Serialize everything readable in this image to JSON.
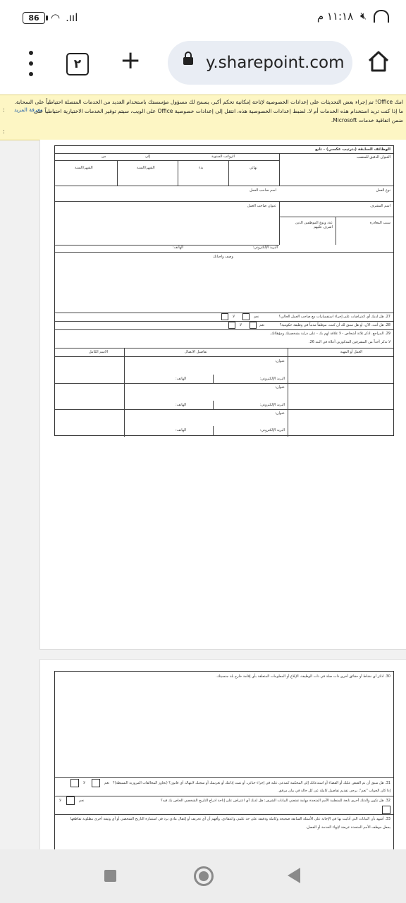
{
  "status_bar": {
    "battery": "86",
    "time": "١١:١٨ م"
  },
  "browser": {
    "tab_count": "٢",
    "url": "y.sharepoint.com"
  },
  "banner": {
    "line1": "امك Office! تم إجراء بعض التحديثات على إعدادات الخصوصية لإتاحة إمكانية تحكم أكبر، يسمح لك مسؤول مؤسستك باستخدام العديد من الخدمات المتصلة احتياطياً على السحابة.",
    "line2": "ما إذا كنت تريد استخدام هذه الخدمات أم لا. لضبط إعدادات الخصوصية هذه، انتقل إلى إعدادات خصوصية Office على الويب، سيتم توفير الخدمات الاختيارية احتياطياً على",
    "line3": "ضمن اتفاقية خدمات Microsoft.",
    "learn_more": "معرفة المزيد",
    "colon": ":"
  },
  "form": {
    "prev_jobs": "الوظائف السابقة (بترتيب عكسي) - تابع",
    "exact_title": "العنوان الدقيق للمنصب",
    "annual_salary": "الرواتب السنوية",
    "from": "من",
    "to": "إلى",
    "month_year": "الشهر/السنة",
    "final": "نهائي",
    "start": "بدء",
    "employer_name": "اسم صاحب العمل",
    "employer_address": "عنوان صاحب العمل",
    "work_type": "نوع العمل",
    "supervisor_name": "اسم المشرف",
    "leave_reason": "سبب المغادرة",
    "subordinates": "عدد ونوع الموظفين الذين اشرف عليهم",
    "email": "البريد الإلكتروني:",
    "phone": "الهاتف:",
    "duties": "وصف واجباتك",
    "q27": "27. هل لديك أي اعتراضات على إجراء استفسارات مع صاحب العمل الحالي؟",
    "q28": "28. هل أنت، الآن، أو هل سبق لك أن كنت، موظفاً مدنياً في وظيفة حكومية؟",
    "yes": "نعم",
    "no": "لا",
    "q29": "29. المراجع. اذكر ثلاثة أشخاص - لا علاقة لهم بك - على دراية بشخصيتك ومؤهلاتك.",
    "q29b": "لا تذكر أحداً من المشرفين المذكورين أعلاه في البند 26.",
    "full_name": "الاسم الكامل",
    "contact_details": "تفاصيل الاتصال",
    "job_profession": "العمل أو المهنة",
    "address": "عنوان:",
    "q30": "30. اذكر أي نشاط أو حقائق أخرى ذات صلة في ذات الوظيفة، الإبلاغ أو المعلومات المتعلقة بأي إقامة خارج بلد جنسيتك.",
    "q31": "31. هل سبق أن تم القبض عليك أو القضاء أو استدعائك إلى المحكمة كمدعى عليه في إجراء جنائي، أو تمت إدانتك أو تغريمك أو سجنك لانتهاك أي قانون؟ (تجاوز المخالفات المرورية البسيطة)؟",
    "q31b": "إذا كان الجواب \"نعم\"، يرجى تقديم تفاصيل كاملة عن كل حالة في بيان مرفق.",
    "q32": "32. هل تكون والدتك أخرى تابعة للمنظمة الأمم المتحدة مهامة تقتضي البيانات الشرف: هل لديك أي اعتراض على إتاحة ادراج التاريخ الشخصي الخاص بك فيه؟",
    "q33": "33. أشهد بأن البيانات التي أدليت بها في الإجابة على الأسئلة السابقة صحيحة وكاملة ودقيقة على حد علمي واعتقادي. وأفهم أن أي تحريف أو إغفال مادي يرد في استمارة التاريخ الشخصي أو أي وثيقة أخرى مطلوبة تقاطعها",
    "q33b": "يجعل موظف الأمم المتحدة عرضة لإنهاء الخدمة أو الفصل."
  }
}
